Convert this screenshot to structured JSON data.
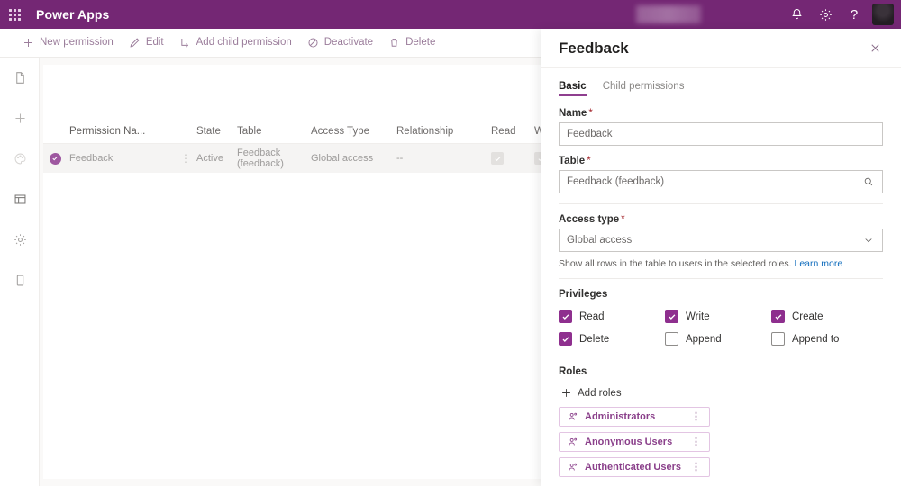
{
  "header": {
    "waffle_icon": "app-launcher-icon",
    "brand": "Power Apps",
    "notifications_icon": "bell-icon",
    "settings_icon": "gear-icon",
    "help_icon": "help-icon",
    "help_glyph": "?",
    "avatar": "user-avatar"
  },
  "command_bar": {
    "items": [
      {
        "label": "New permission",
        "icon": "plus-icon"
      },
      {
        "label": "Edit",
        "icon": "pencil-icon"
      },
      {
        "label": "Add child permission",
        "icon": "add-child-icon"
      },
      {
        "label": "Deactivate",
        "icon": "block-icon"
      },
      {
        "label": "Delete",
        "icon": "trash-icon"
      }
    ]
  },
  "rail": {
    "items": [
      {
        "name": "pages-icon"
      },
      {
        "name": "add-icon"
      },
      {
        "name": "theme-palette-icon"
      },
      {
        "name": "layout-window-icon"
      },
      {
        "name": "settings-gear-icon"
      },
      {
        "name": "mobile-device-icon"
      }
    ]
  },
  "grid": {
    "columns": [
      "Permission Na...",
      "State",
      "Table",
      "Access Type",
      "Relationship",
      "Read",
      "Writ"
    ],
    "rows": [
      {
        "selected": true,
        "name": "Feedback",
        "state": "Active",
        "table": "Feedback (feedback)",
        "access_type": "Global access",
        "relationship": "--",
        "read": true,
        "write": true,
        "overflow": "⋮"
      }
    ]
  },
  "panel": {
    "title": "Feedback",
    "close_icon": "close-icon",
    "tabs": [
      {
        "label": "Basic",
        "active": true
      },
      {
        "label": "Child permissions",
        "active": false
      }
    ],
    "fields": {
      "name": {
        "label": "Name",
        "required": "*",
        "value": "Feedback"
      },
      "table": {
        "label": "Table",
        "required": "*",
        "value": "Feedback (feedback)",
        "icon": "search-icon"
      },
      "access_type": {
        "label": "Access type",
        "required": "*",
        "value": "Global access",
        "icon": "chevron-down-icon",
        "helper_text": "Show all rows in the table to users in the selected roles.",
        "helper_link": "Learn more"
      }
    },
    "privileges": {
      "title": "Privileges",
      "items": [
        {
          "label": "Read",
          "checked": true
        },
        {
          "label": "Write",
          "checked": true
        },
        {
          "label": "Create",
          "checked": true
        },
        {
          "label": "Delete",
          "checked": true
        },
        {
          "label": "Append",
          "checked": false
        },
        {
          "label": "Append to",
          "checked": false
        }
      ]
    },
    "roles": {
      "title": "Roles",
      "add_label": "Add roles",
      "add_icon": "plus-icon",
      "items": [
        {
          "label": "Administrators",
          "icon": "person-role-icon",
          "overflow": "⋮"
        },
        {
          "label": "Anonymous Users",
          "icon": "person-role-icon",
          "overflow": "⋮"
        },
        {
          "label": "Authenticated Users",
          "icon": "person-role-icon",
          "overflow": "⋮"
        }
      ]
    }
  },
  "colors": {
    "brand_purple": "#742774",
    "accent_purple": "#8e2f8e",
    "link_blue": "#0f6cbd",
    "required_red": "#a4262c"
  }
}
